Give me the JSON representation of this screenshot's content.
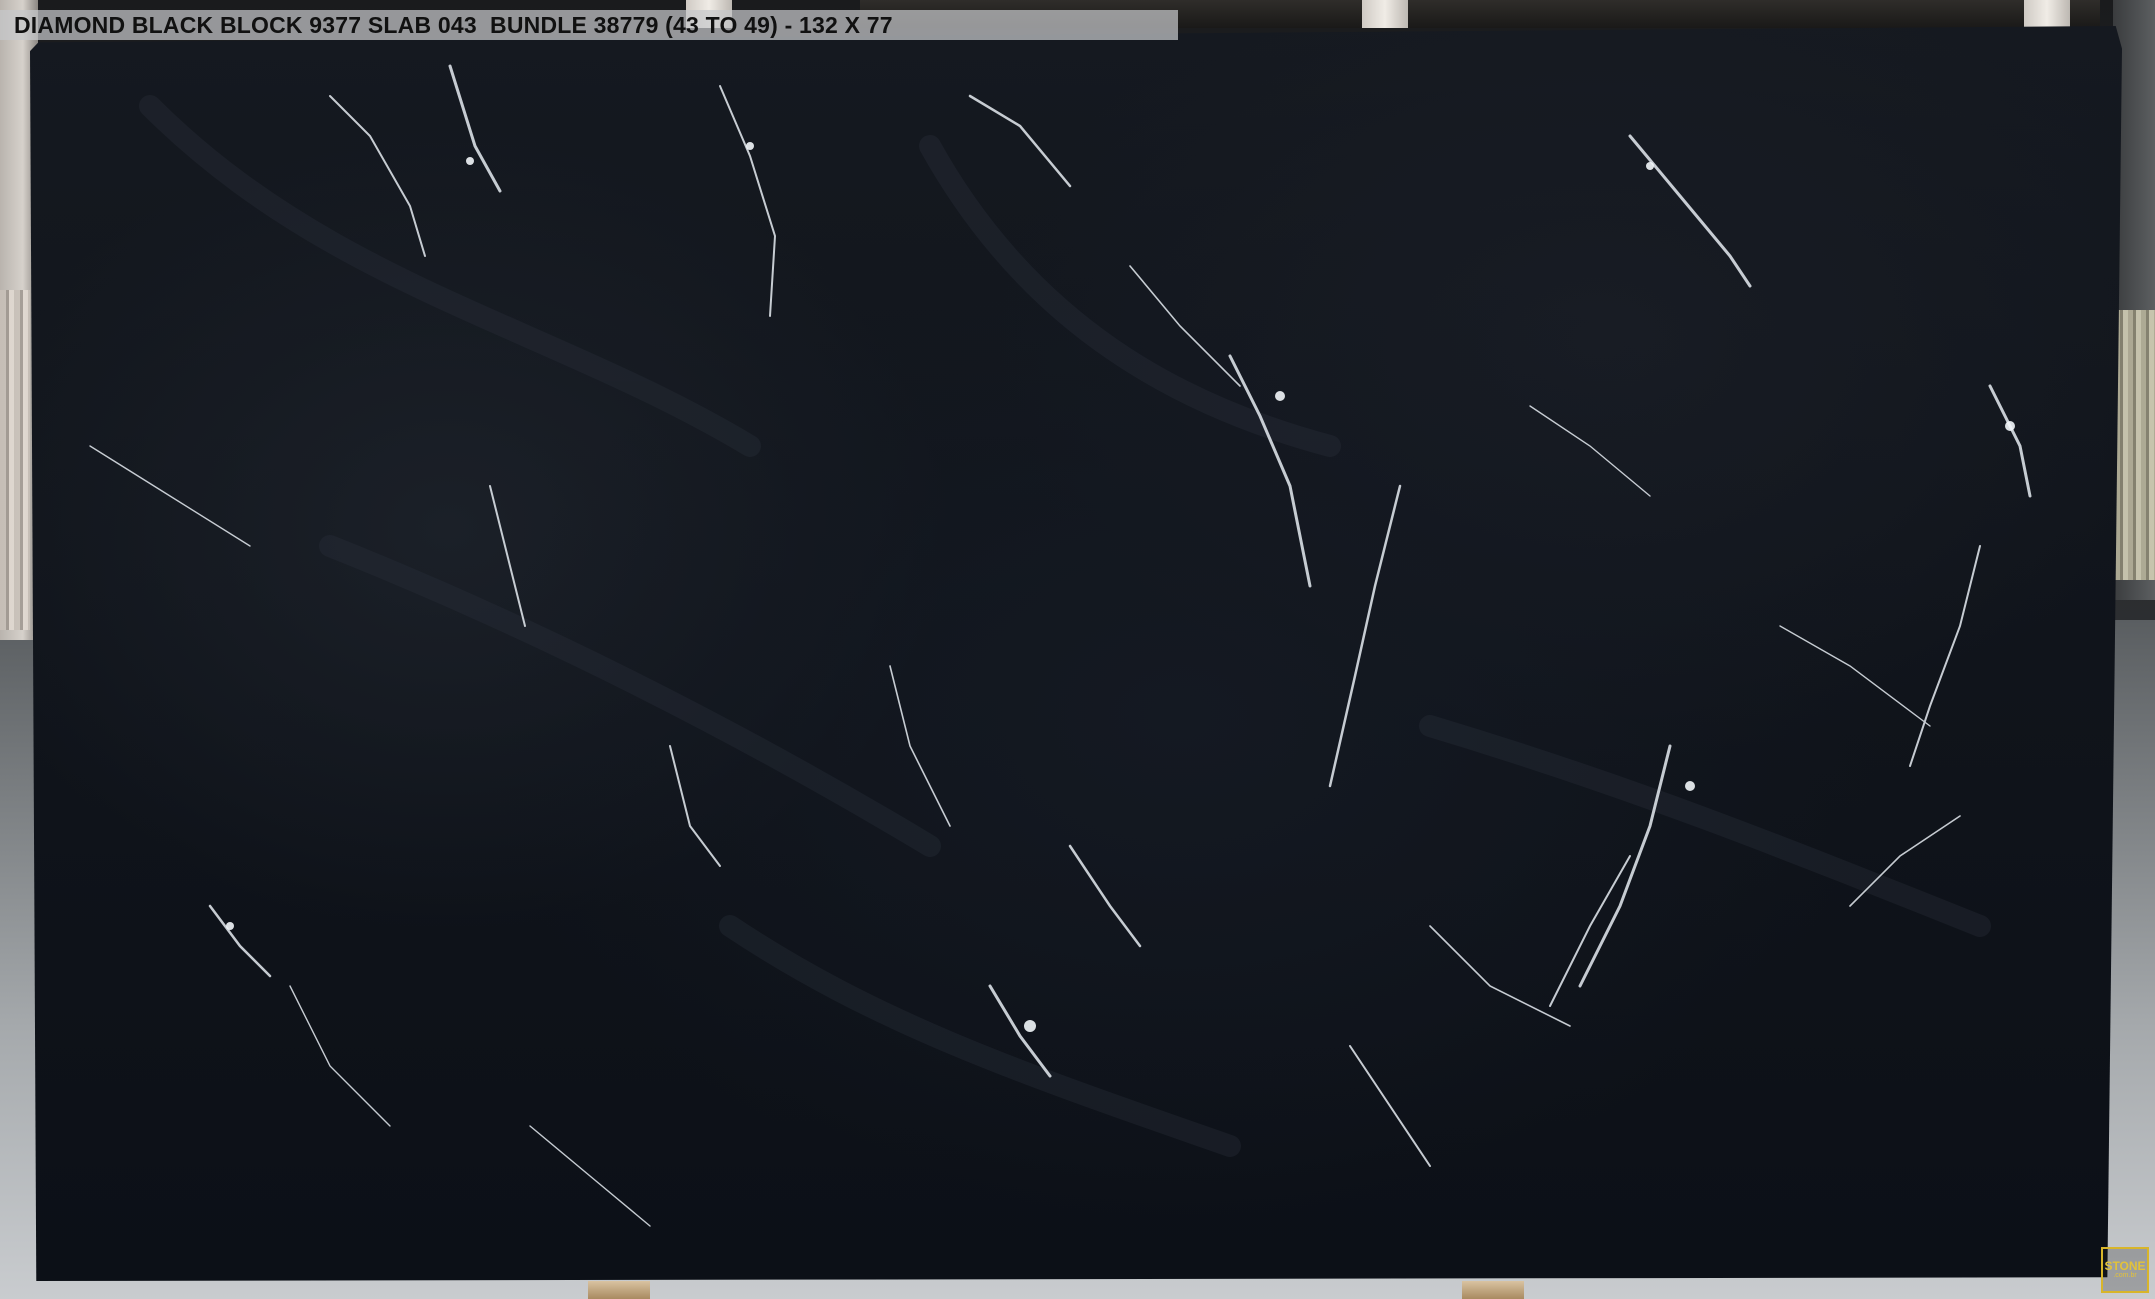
{
  "caption": {
    "text": "DIAMOND BLACK BLOCK 9377 SLAB 043  BUNDLE 38779 (43 TO 49) - 132 X 77"
  },
  "watermark": {
    "brand": "STONE",
    "domain": ".com.br"
  },
  "colors": {
    "slab_base": "#10141b",
    "vein": "#e6ecf2",
    "caption_bg": "#c6c8ca",
    "logo_accent": "#d8b52a"
  }
}
